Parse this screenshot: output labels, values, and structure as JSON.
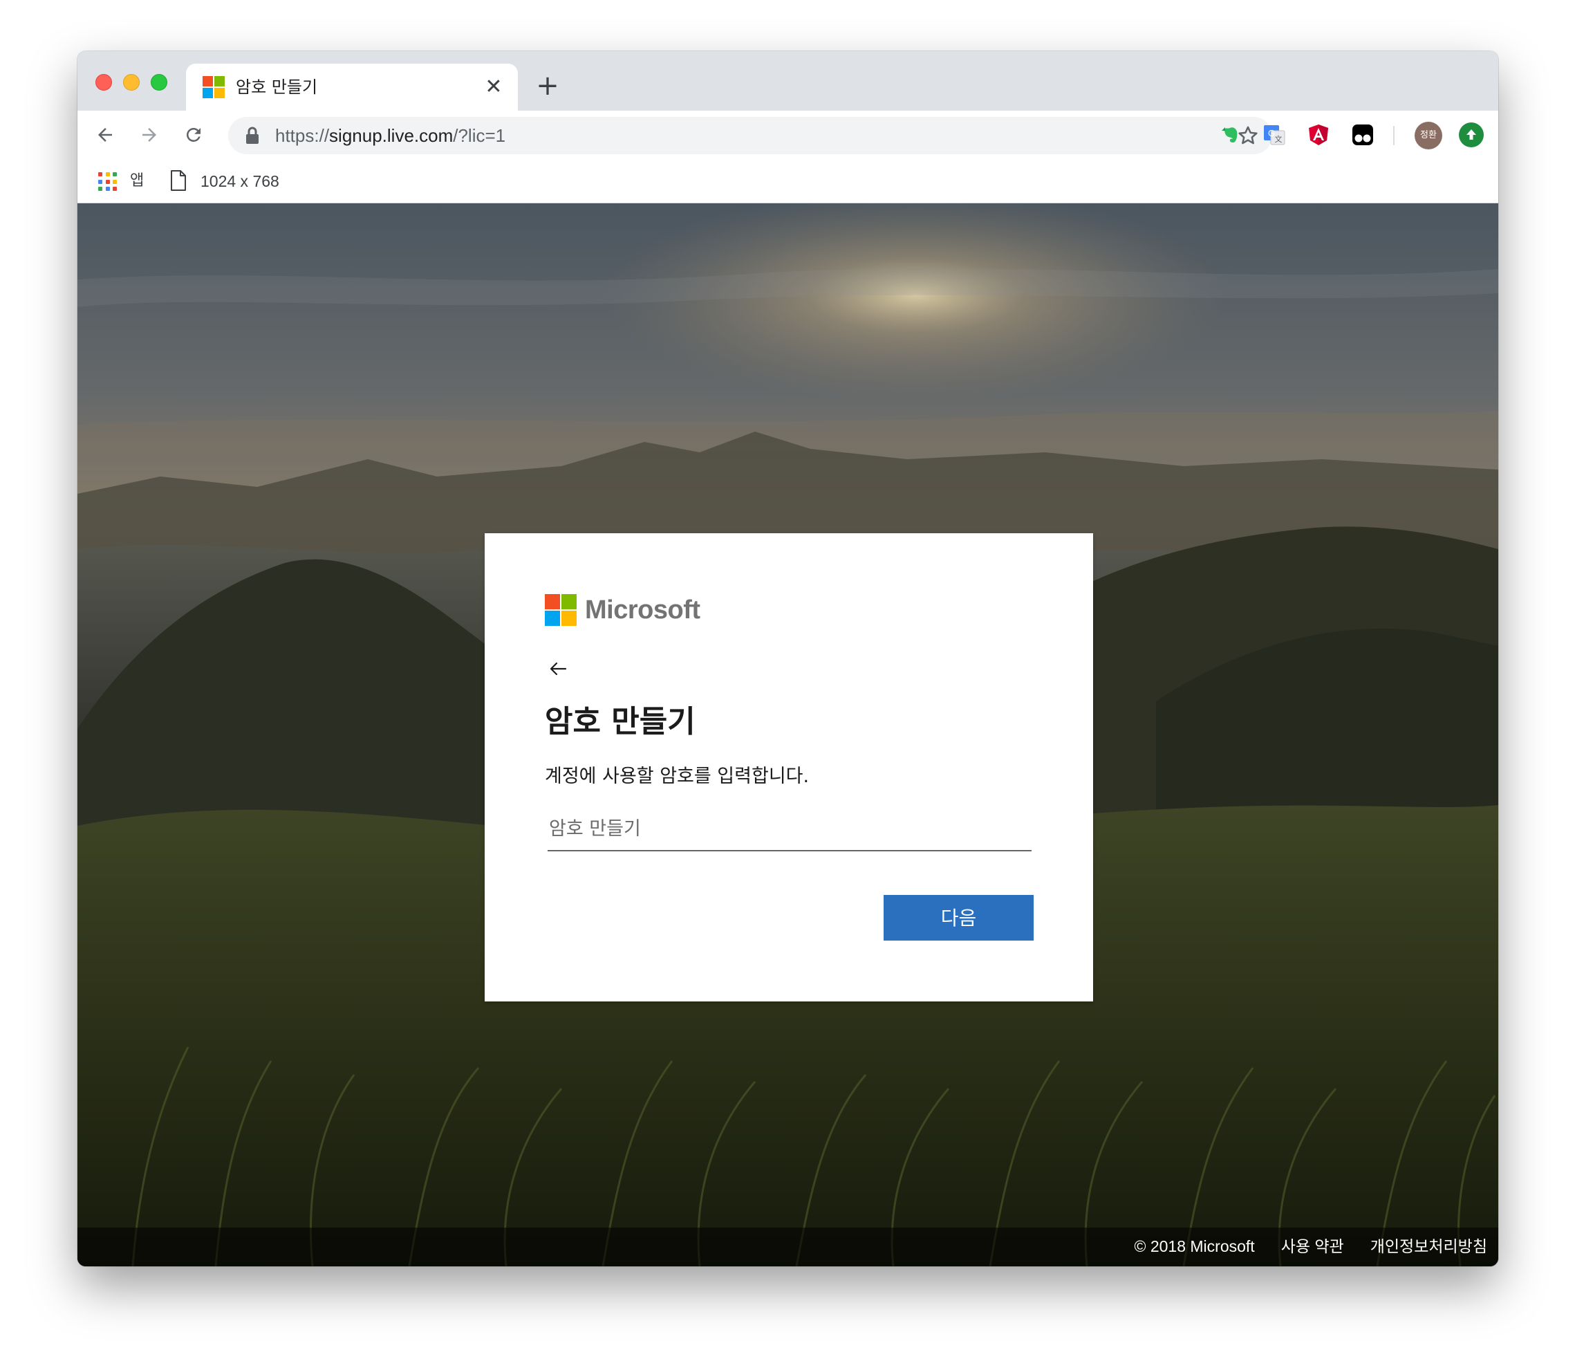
{
  "browser": {
    "tab_title": "암호 만들기",
    "url_scheme": "https://",
    "url_host": "signup.live.com",
    "url_path": "/?lic=1",
    "profile_initials": "정환",
    "icons": {
      "back": "arrow-left-icon",
      "forward": "arrow-right-icon",
      "reload": "reload-icon",
      "lock": "lock-icon",
      "bookmark": "star-icon",
      "extensions": [
        "evernote-icon",
        "google-translate-icon",
        "angular-icon",
        "tampermonkey-icon"
      ],
      "update": "update-arrow-icon"
    }
  },
  "bookmarks": {
    "apps_label": "앱",
    "items": [
      {
        "label": "1024 x 768"
      }
    ]
  },
  "card": {
    "brand": "Microsoft",
    "title": "암호 만들기",
    "description": "계정에 사용할 암호를 입력합니다.",
    "password_placeholder": "암호 만들기",
    "password_value": "",
    "next_label": "다음"
  },
  "footer": {
    "copyright": "© 2018 Microsoft",
    "terms": "사용 약관",
    "privacy": "개인정보처리방침"
  },
  "colors": {
    "ms_red": "#f25022",
    "ms_green": "#7fba00",
    "ms_blue": "#00a4ef",
    "ms_yellow": "#ffb900",
    "primary_button": "#2b6fbf",
    "tab_strip": "#dee1e6"
  }
}
